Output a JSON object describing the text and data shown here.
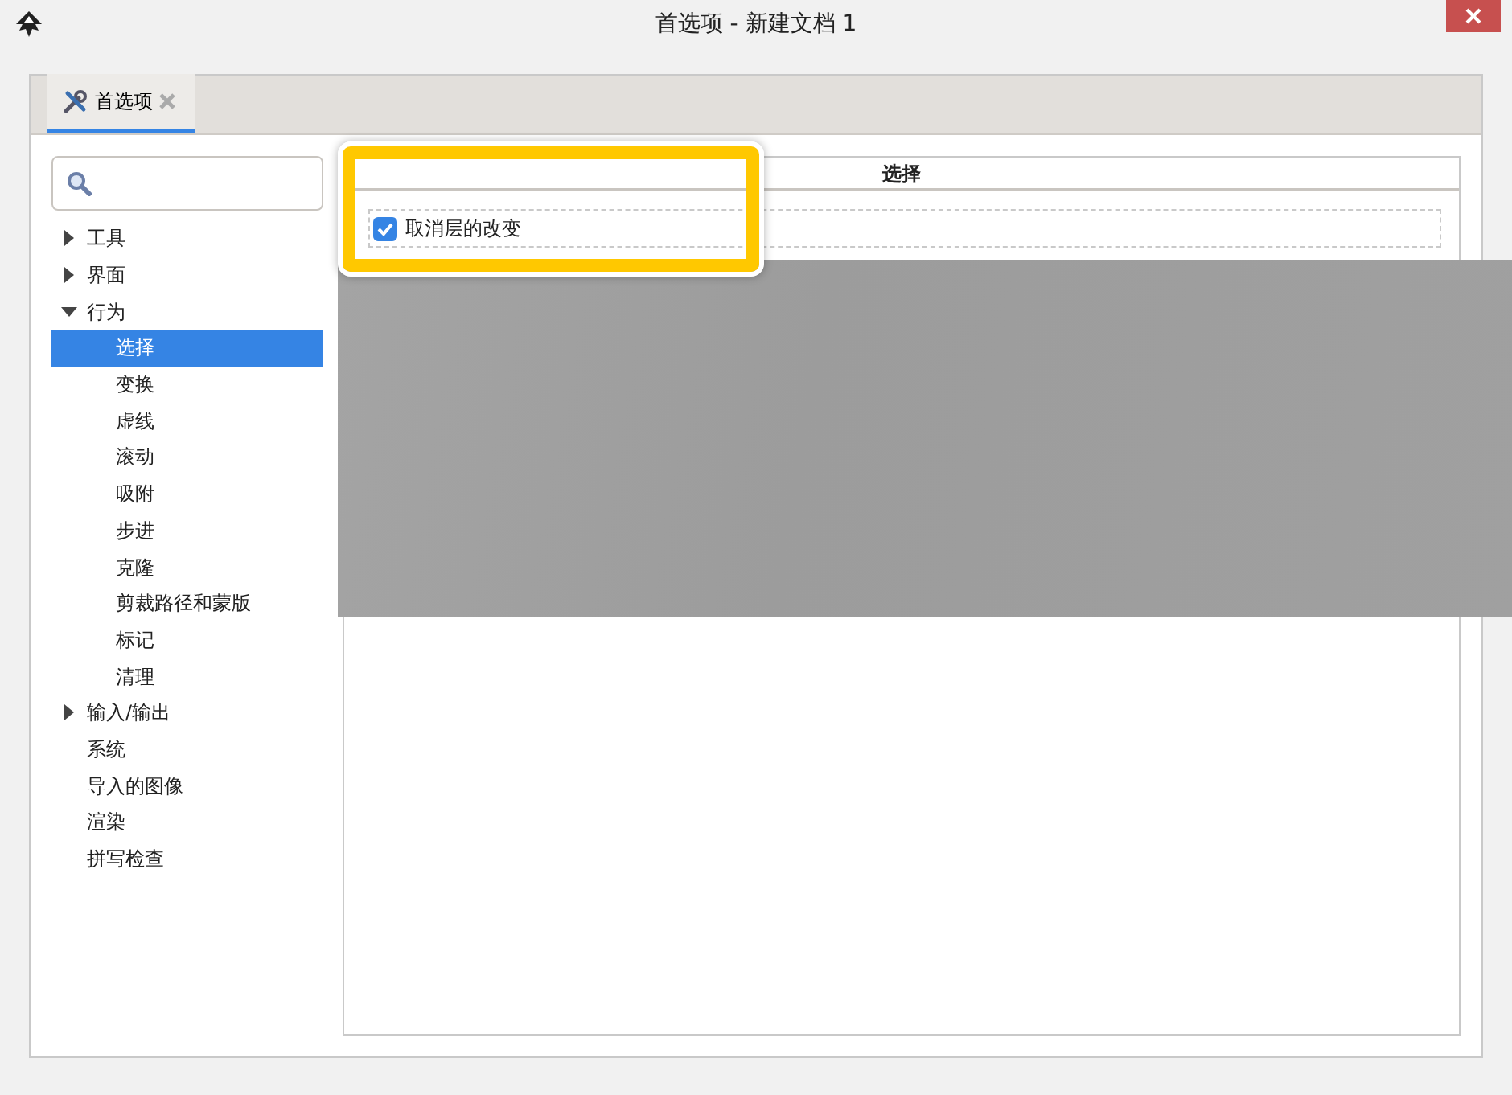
{
  "window": {
    "title": "首选项 - 新建文档 1"
  },
  "tabs": [
    {
      "label": "首选项",
      "selected": true
    }
  ],
  "sidebar": {
    "items": [
      {
        "label": "工具",
        "expanded": false,
        "selected": false
      },
      {
        "label": "界面",
        "expanded": false,
        "selected": false
      },
      {
        "label": "行为",
        "expanded": true,
        "selected": false,
        "children": [
          {
            "label": "选择",
            "selected": true
          },
          {
            "label": "变换",
            "selected": false
          },
          {
            "label": "虚线",
            "selected": false
          },
          {
            "label": "滚动",
            "selected": false
          },
          {
            "label": "吸附",
            "selected": false
          },
          {
            "label": "步进",
            "selected": false
          },
          {
            "label": "克隆",
            "selected": false
          },
          {
            "label": "剪裁路径和蒙版",
            "selected": false
          },
          {
            "label": "标记",
            "selected": false
          },
          {
            "label": "清理",
            "selected": false
          }
        ]
      },
      {
        "label": "输入/输出",
        "expanded": false,
        "selected": false
      },
      {
        "label": "系统",
        "selected": false
      },
      {
        "label": "导入的图像",
        "selected": false
      },
      {
        "label": "渲染",
        "selected": false
      },
      {
        "label": "拼写检查",
        "selected": false
      }
    ]
  },
  "panel": {
    "title": "选择",
    "options": [
      {
        "label": "取消层的改变",
        "checked": true
      }
    ]
  }
}
